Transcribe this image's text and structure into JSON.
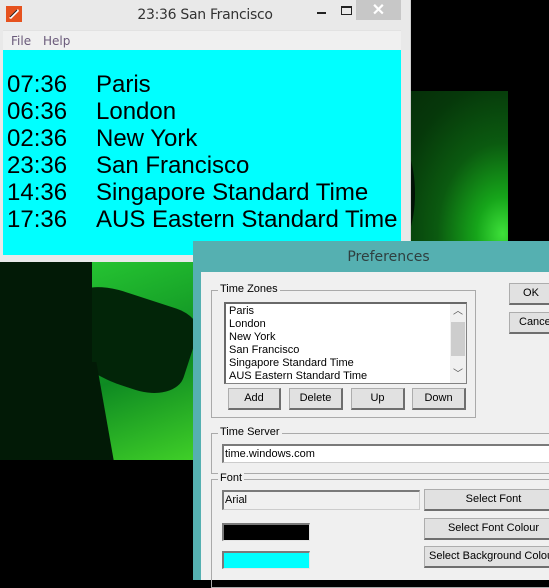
{
  "main_window": {
    "title": "23:36 San Francisco",
    "menu": [
      "File",
      "Help"
    ],
    "background_color": "#00ffff",
    "font_color": "#000000",
    "clocks": [
      {
        "time": "07:36",
        "zone": "Paris"
      },
      {
        "time": "06:36",
        "zone": "London"
      },
      {
        "time": "02:36",
        "zone": "New York"
      },
      {
        "time": "23:36",
        "zone": "San Francisco"
      },
      {
        "time": "14:36",
        "zone": "Singapore Standard Time"
      },
      {
        "time": "17:36",
        "zone": "AUS Eastern Standard Time"
      }
    ]
  },
  "preferences": {
    "title": "Preferences",
    "time_zones": {
      "label": "Time Zones",
      "items": [
        "Paris",
        "London",
        "New York",
        "San Francisco",
        "Singapore Standard Time",
        "AUS Eastern Standard Time"
      ],
      "buttons": {
        "add": "Add",
        "delete": "Delete",
        "up": "Up",
        "down": "Down"
      }
    },
    "time_server": {
      "label": "Time Server",
      "value": "time.windows.com"
    },
    "font": {
      "label": "Font",
      "value": "Arial",
      "select_font": "Select Font",
      "select_font_colour": "Select Font Colour",
      "select_background_colour": "Select Background Colour",
      "font_colour": "#000000",
      "background_colour": "#00ffff"
    },
    "ok": "OK",
    "cancel": "Cancel"
  }
}
